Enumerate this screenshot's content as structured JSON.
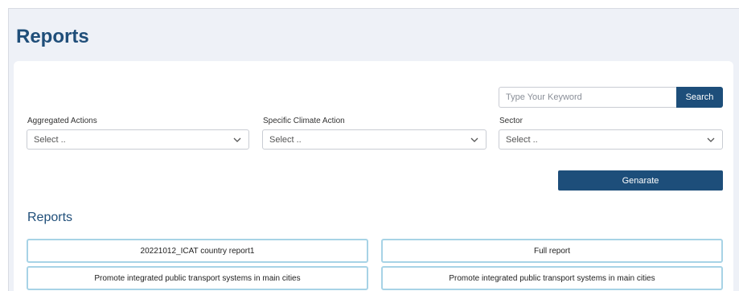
{
  "page": {
    "title": "Reports"
  },
  "search": {
    "placeholder": "Type Your Keyword",
    "button_label": "Search"
  },
  "filters": {
    "aggregated_actions": {
      "label": "Aggregated Actions",
      "value": "Select .."
    },
    "specific_climate_action": {
      "label": "Specific Climate Action",
      "value": "Select .."
    },
    "sector": {
      "label": "Sector",
      "value": "Select .."
    }
  },
  "generate": {
    "label": "Genarate"
  },
  "reports": {
    "title": "Reports",
    "items": [
      "20221012_ICAT country report1",
      "Full report",
      "Promote integrated public transport systems in main cities",
      "Promote integrated public transport systems in main cities"
    ]
  },
  "colors": {
    "accent": "#1d4e7a",
    "title": "#1f4e79",
    "report_border": "#a7d3e6",
    "background": "#eef1f7"
  }
}
